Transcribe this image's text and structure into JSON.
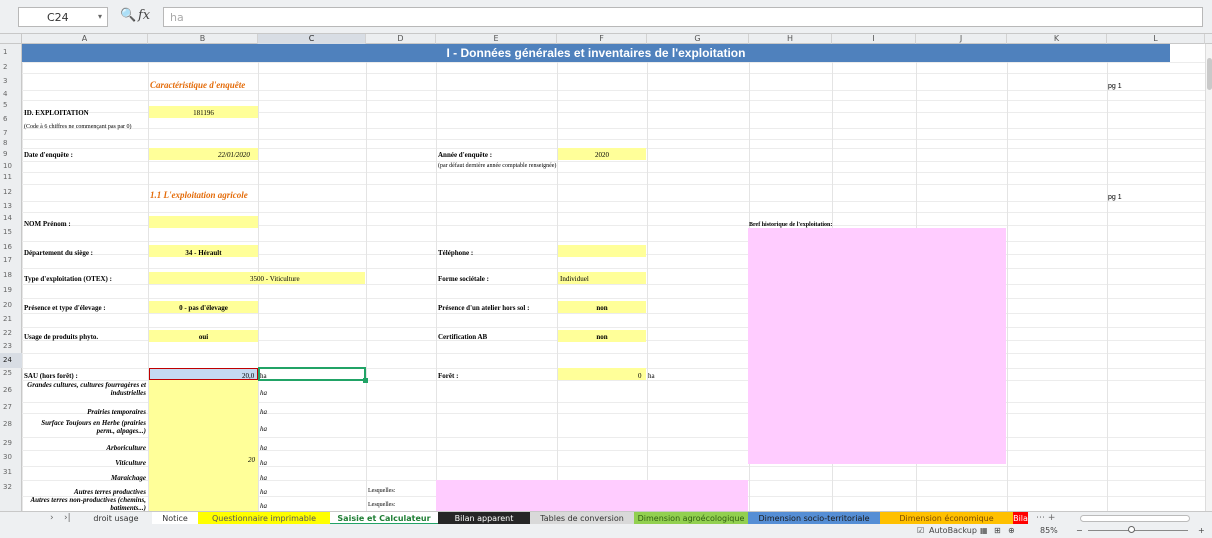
{
  "formula_bar": {
    "cell_ref": "C24",
    "formula_value": "ha"
  },
  "columns": [
    "A",
    "B",
    "C",
    "D",
    "E",
    "F",
    "G",
    "H",
    "I",
    "J",
    "K",
    "L"
  ],
  "rows": [
    "1",
    "2",
    "3",
    "4",
    "5",
    "6",
    "7",
    "8",
    "9",
    "10",
    "11",
    "12",
    "13",
    "14",
    "15",
    "16",
    "17",
    "18",
    "19",
    "20",
    "21",
    "22",
    "23",
    "24",
    "25",
    "26",
    "27",
    "28",
    "29",
    "30",
    "31",
    "32"
  ],
  "sheet": {
    "title": "I - Données générales et inventaires de l'exploitation",
    "section_enquete": "Caractéristique d'enquête",
    "section_exploitation": "1.1 L'exploitation agricole",
    "pg1": "pg 1",
    "pg1b": "pg 1",
    "id_label": "ID. EXPLOITATION",
    "id_value": "181196",
    "id_note": "(Code à 6 chiffres ne commençant pas par 0)",
    "date_label": "Date d'enquête :",
    "date_value": "22/01/2020",
    "annee_label": "Année d'enquête :",
    "annee_value": "2020",
    "annee_note": "(par défaut dernière année comptable renseignée)",
    "nom_label": "NOM Prénom :",
    "historique_label": "Bref historique de l'exploitation:",
    "departement_label": "Département du siège :",
    "departement_value": "34 - Hérault",
    "telephone_label": "Téléphone :",
    "otex_label": "Type d'exploitation (OTEX) :",
    "otex_value": "3500 - Viticulture",
    "forme_label": "Forme sociétale :",
    "forme_value": "Individuel",
    "elevage_label": "Présence et type d'élevage :",
    "elevage_value": "0 - pas d'élevage",
    "atelier_label": "Présence d'un atelier hors sol :",
    "atelier_value": "non",
    "phyto_label": "Usage de produits phyto.",
    "phyto_value": "oui",
    "ab_label": "Certification AB",
    "ab_value": "non",
    "sau_label": "SAU (hors forêt) :",
    "sau_value": "20,0",
    "sau_unit": "ha",
    "foret_label": "Forêt :",
    "foret_value": "0",
    "foret_unit": "ha",
    "grandes_cultures": "Grandes cultures, cultures fourragères et industrielles",
    "prairies_temp": "Prairies temporaires",
    "stoh": "Surface Toujours en Herbe (prairies perm., alpages...)",
    "arboriculture": "Arboriculture",
    "viticulture": "Viticulture",
    "viticulture_value": "20",
    "maraichage": "Maraichage",
    "autres_prod": "Autres terres productives",
    "autres_nonprod": "Autres terres non-productives (chemins, batiments...)",
    "lesquelles": "Lesquelles:",
    "unit_ha": "ha"
  },
  "tabs": [
    {
      "label": "droit usage",
      "color": "#eef0f2"
    },
    {
      "label": "Notice",
      "color": "#ffffff"
    },
    {
      "label": "Questionnaire imprimable",
      "color": "#ffff00"
    },
    {
      "label": "Saisie et Calculateur",
      "color": "#ffffff"
    },
    {
      "label": "Bilan apparent",
      "color": "#262626"
    },
    {
      "label": "Tables de conversion",
      "color": "#d9d9d9"
    },
    {
      "label": "Dimension agroécologique",
      "color": "#92d050"
    },
    {
      "label": "Dimension socio-territoriale",
      "color": "#558ed5"
    },
    {
      "label": "Dimension économique",
      "color": "#ffc000"
    },
    {
      "label": "Bila",
      "color": "#ff0000"
    }
  ],
  "status_bar": {
    "autobackup": "AutoBackup",
    "zoom": "85%"
  }
}
